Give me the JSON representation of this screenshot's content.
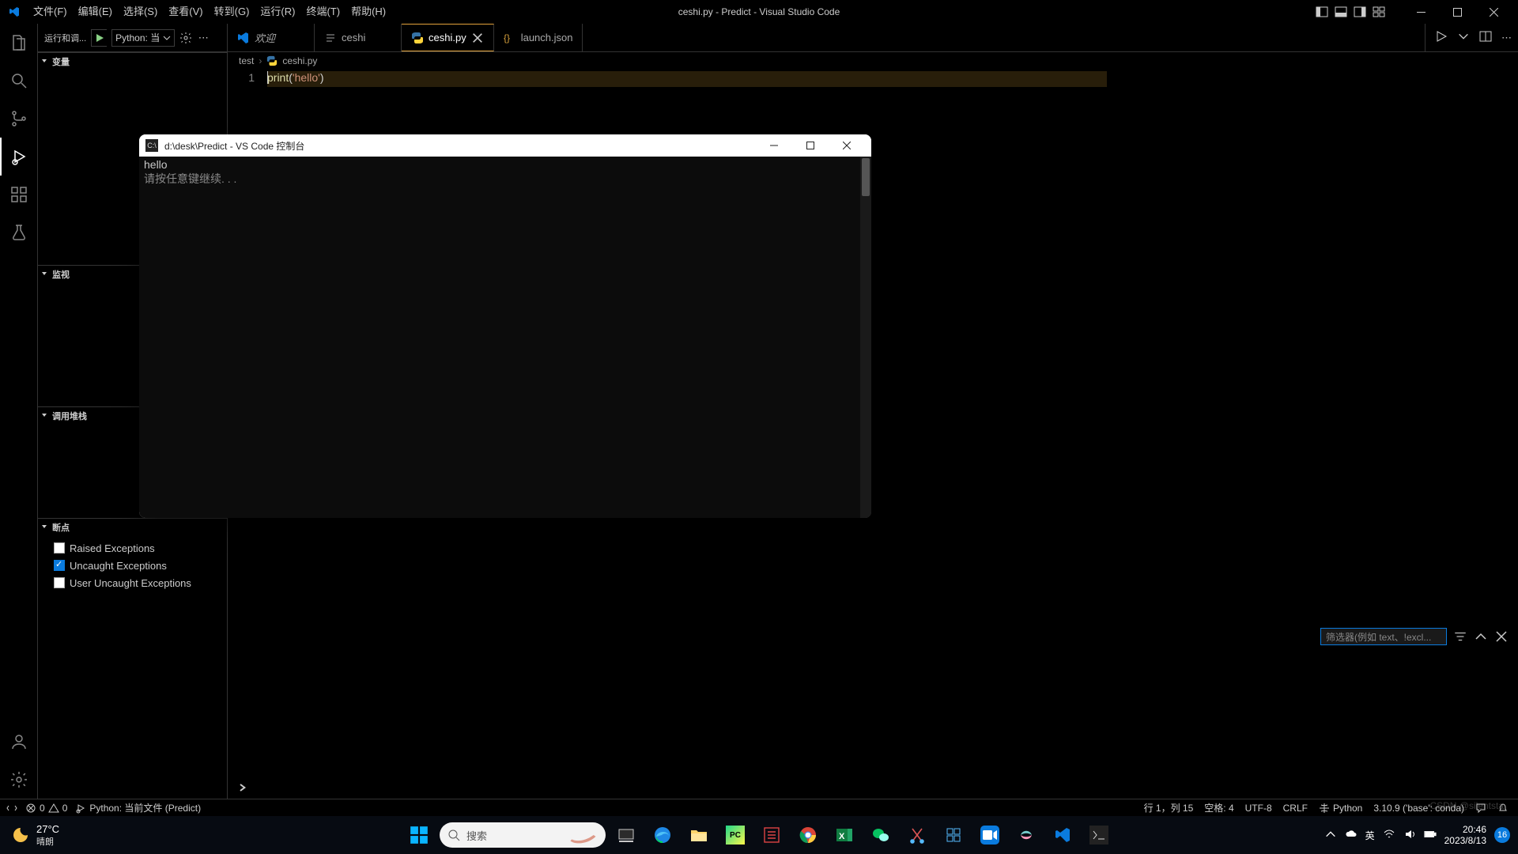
{
  "window_title": "ceshi.py - Predict - Visual Studio Code",
  "menu": [
    "文件(F)",
    "编辑(E)",
    "选择(S)",
    "查看(V)",
    "转到(G)",
    "运行(R)",
    "终端(T)",
    "帮助(H)"
  ],
  "run_debug": {
    "title": "运行和调...",
    "config": "Python: 当"
  },
  "sidebar_sections": {
    "variables": "变量",
    "watch": "监视",
    "callstack": "调用堆栈",
    "breakpoints": "断点"
  },
  "breakpoints": [
    {
      "label": "Raised Exceptions",
      "checked": false
    },
    {
      "label": "Uncaught Exceptions",
      "checked": true
    },
    {
      "label": "User Uncaught Exceptions",
      "checked": false
    }
  ],
  "tabs": [
    {
      "label": "欢迎",
      "icon": "vscode"
    },
    {
      "label": "ceshi",
      "icon": "text"
    },
    {
      "label": "ceshi.py",
      "icon": "python",
      "active": true,
      "close": true
    },
    {
      "label": "launch.json",
      "icon": "json"
    }
  ],
  "breadcrumb": {
    "root": "test",
    "file": "ceshi.py"
  },
  "code": {
    "lineno": "1",
    "fn": "print",
    "open": "(",
    "str": "'hello'",
    "close": ")"
  },
  "filter_placeholder": "筛选器(例如 text、!excl...",
  "console": {
    "title": "d:\\desk\\Predict - VS Code 控制台",
    "out": "hello",
    "prompt": "请按任意键继续. . ."
  },
  "status": {
    "errors": "0",
    "warnings": "0",
    "interp": "Python: 当前文件 (Predict)",
    "pos": "行 1，列 15",
    "spaces": "空格: 4",
    "encoding": "UTF-8",
    "eol": "CRLF",
    "lang": "Python",
    "env": "3.10.9 ('base': conda)"
  },
  "taskbar": {
    "temp": "27°C",
    "cond": "晴朗",
    "search": "搜索",
    "ime": "英",
    "time": "20:46",
    "date": "2023/8/13",
    "notif": "16"
  },
  "watermark": "CSDN @silentsta"
}
